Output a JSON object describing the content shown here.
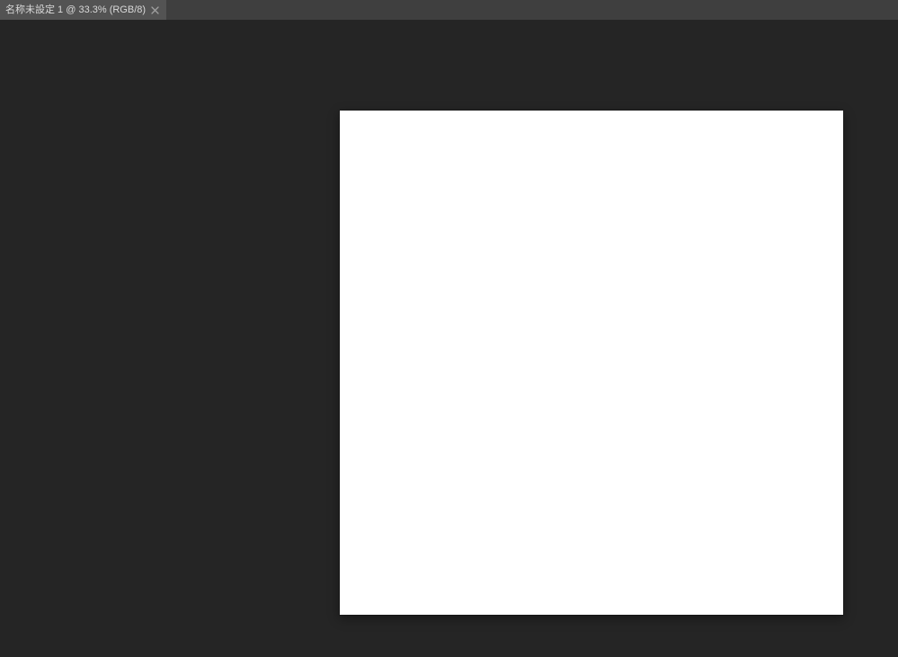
{
  "tabs": [
    {
      "label": "名称未設定 1 @ 33.3% (RGB/8)"
    }
  ]
}
